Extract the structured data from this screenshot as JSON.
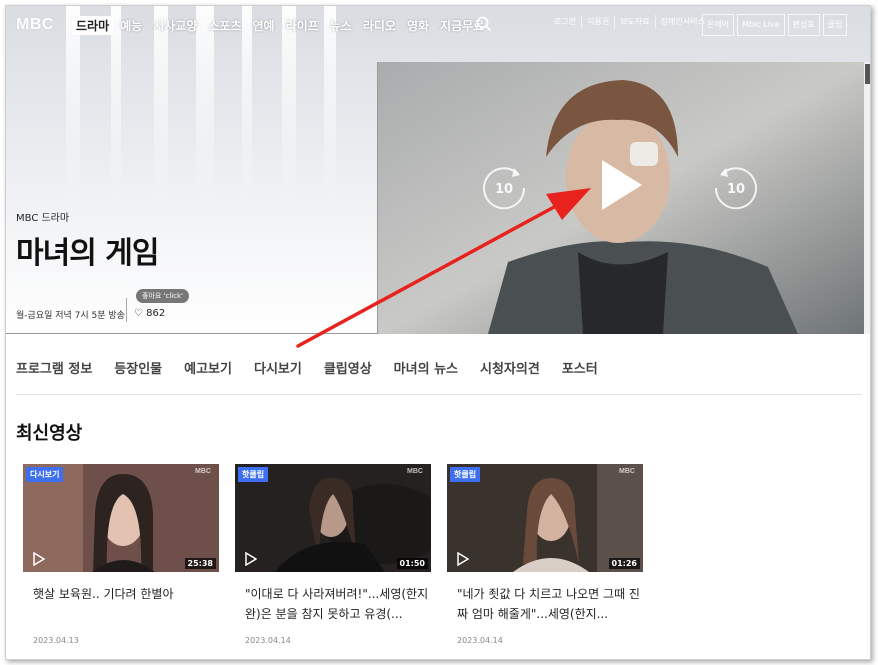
{
  "gnb": {
    "logo": "MBC",
    "menu": [
      "드라마",
      "예능",
      "시사교양",
      "스포츠",
      "연예",
      "라이프",
      "뉴스",
      "라디오",
      "영화",
      "지금무료"
    ],
    "util_links": [
      "로그인",
      "이용권",
      "보도자료",
      "장애인서비스"
    ],
    "util_buttons": [
      "온에어",
      "Mbic Live",
      "편성표",
      "클립"
    ]
  },
  "program": {
    "channel": "MBC 드라마",
    "title": "마녀의 게임",
    "schedule": "월-금요일 저녁 7시 5분 방송",
    "like_tip": "좋아요 'click'",
    "like_count": "♡ 862"
  },
  "player": {
    "rewind_label": "10",
    "forward_label": "10"
  },
  "tabs": [
    "프로그램 정보",
    "등장인물",
    "예고보기",
    "다시보기",
    "클립영상",
    "마녀의 뉴스",
    "시청자의견",
    "포스터"
  ],
  "latest": {
    "title": "최신영상",
    "videos": [
      {
        "badge": "다시보기",
        "watermark": "MBC",
        "duration": "25:38",
        "title": "햇살 보육원.. 기다려 한별아",
        "date": "2023.04.13",
        "tone": "#7a5a54"
      },
      {
        "badge": "핫클립",
        "watermark": "MBC",
        "duration": "01:50",
        "title": "\"이대로 다 사라져버려!\"...세영(한지완)은 분을 참지 못하고 유경(...",
        "date": "2023.04.14",
        "tone": "#2a2622"
      },
      {
        "badge": "핫클립",
        "watermark": "MBC",
        "duration": "01:26",
        "title": "\"네가 죗값 다 치르고 나오면 그때 진짜 엄마 해줄게\"...세영(한지...",
        "date": "2023.04.14",
        "tone": "#3d3530"
      }
    ]
  },
  "colors": {
    "badge": "#3d6ff0",
    "arrow": "#e8221d"
  }
}
